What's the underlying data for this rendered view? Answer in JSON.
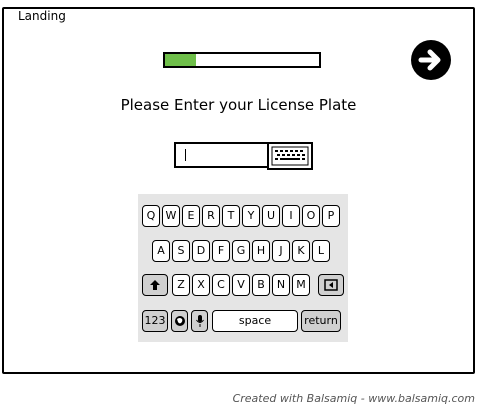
{
  "window": {
    "title": "Landing"
  },
  "progress": {
    "value_fraction": 0.2,
    "fill_color": "#6fbf4a"
  },
  "next_button": {
    "icon": "arrow-right-icon"
  },
  "prompt": {
    "text": "Please Enter your License Plate"
  },
  "plate_input": {
    "value": ""
  },
  "keyboard_button": {
    "icon": "keyboard-icon"
  },
  "keyboard": {
    "row1": [
      "Q",
      "W",
      "E",
      "R",
      "T",
      "Y",
      "U",
      "I",
      "O",
      "P"
    ],
    "row2": [
      "A",
      "S",
      "D",
      "F",
      "G",
      "H",
      "J",
      "K",
      "L"
    ],
    "row3": [
      "Z",
      "X",
      "C",
      "V",
      "B",
      "N",
      "M"
    ],
    "row4": {
      "numbers": "123",
      "space": "space",
      "return": "return"
    },
    "icons": {
      "shift": "shift-icon",
      "backspace": "backspace-icon",
      "globe": "globe-icon",
      "mic": "microphone-icon"
    }
  },
  "footer": {
    "text": "Created with Balsamiq - www.balsamiq.com"
  }
}
